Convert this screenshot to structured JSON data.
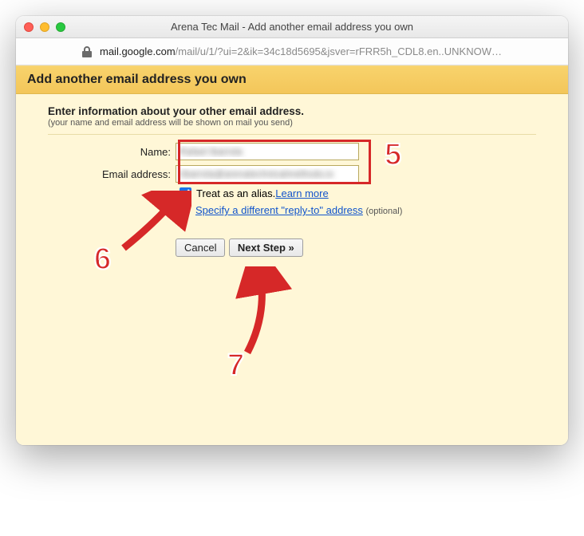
{
  "window": {
    "title": "Arena Tec Mail - Add another email address you own"
  },
  "url": {
    "host": "mail.google.com",
    "path": "/mail/u/1/?ui=2&ik=34c18d5695&jsver=rFRR5h_CDL8.en..UNKNOW…"
  },
  "header": {
    "title": "Add another email address you own"
  },
  "intro": {
    "title": "Enter information about your other email address.",
    "sub": "(your name and email address will be shown on mail you send)"
  },
  "form": {
    "name_label": "Name:",
    "name_value": "Rafael Ibarrola",
    "email_label": "Email address:",
    "email_value": "ribarrola@arenatechnicalmethods.io",
    "alias_label": "Treat as an alias. ",
    "learn_more": "Learn more",
    "reply_to": "Specify a different \"reply-to\" address",
    "optional": " (optional)"
  },
  "buttons": {
    "cancel": "Cancel",
    "next": "Next Step »"
  },
  "annotations": {
    "a5": "5",
    "a6": "6",
    "a7": "7"
  }
}
